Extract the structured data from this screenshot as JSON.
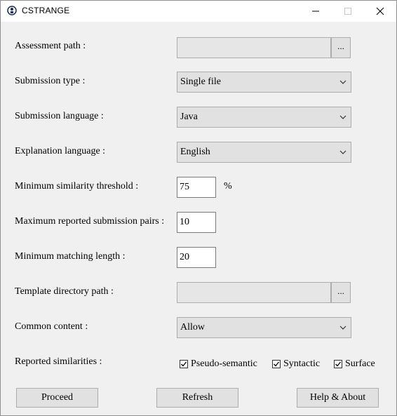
{
  "window": {
    "title": "CSTRANGE"
  },
  "form": {
    "assessment_path": {
      "label": "Assessment path :",
      "value": "",
      "browse": "..."
    },
    "submission_type": {
      "label": "Submission type :",
      "value": "Single file"
    },
    "submission_language": {
      "label": "Submission language :",
      "value": "Java"
    },
    "explanation_language": {
      "label": "Explanation language :",
      "value": "English"
    },
    "min_similarity": {
      "label": "Minimum similarity threshold :",
      "value": "75",
      "unit": "%"
    },
    "max_pairs": {
      "label": "Maximum reported submission pairs :",
      "value": "10"
    },
    "min_matching_length": {
      "label": "Minimum matching length :",
      "value": "20"
    },
    "template_path": {
      "label": "Template directory path :",
      "value": "",
      "browse": "..."
    },
    "common_content": {
      "label": "Common content :",
      "value": "Allow"
    },
    "reported_similarities": {
      "label": "Reported similarities :",
      "options": [
        {
          "label": "Pseudo-semantic",
          "checked": true
        },
        {
          "label": "Syntactic",
          "checked": true
        },
        {
          "label": "Surface",
          "checked": true
        }
      ]
    }
  },
  "buttons": {
    "proceed": "Proceed",
    "refresh": "Refresh",
    "help": "Help & About"
  }
}
